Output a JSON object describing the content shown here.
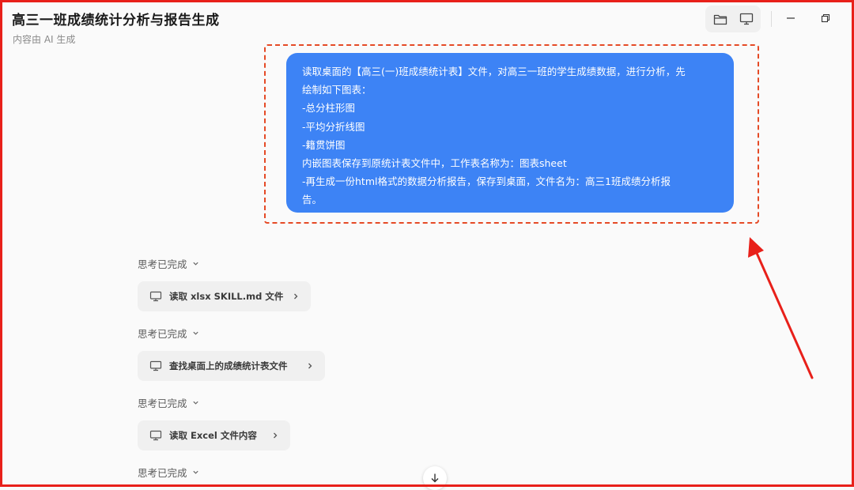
{
  "header": {
    "title": "高三一班成绩统计分析与报告生成",
    "subtitle": "内容由 AI 生成"
  },
  "toolbar": {
    "icons": [
      "folder-icon",
      "monitor-icon"
    ],
    "window_controls": [
      "minimize-icon",
      "restore-icon"
    ]
  },
  "prompt": {
    "lines": [
      "读取桌面的【高三(一)班成绩统计表】文件，对高三一班的学生成绩数据，进行分析，先",
      "绘制如下图表：",
      "-总分柱形图",
      "-平均分折线图",
      "-籍贯饼图",
      "内嵌图表保存到原统计表文件中，工作表名称为：图表sheet",
      "-再生成一份html格式的数据分析报告，保存到桌面，文件名为：高三1班成绩分析报",
      "告。"
    ]
  },
  "steps": [
    {
      "think_label": "思考已完成",
      "tool_label": "读取 xlsx SKILL.md 文件"
    },
    {
      "think_label": "思考已完成",
      "tool_label": "查找桌面上的成绩统计表文件"
    },
    {
      "think_label": "思考已完成",
      "tool_label": "读取 Excel 文件内容"
    },
    {
      "think_label": "思考已完成"
    }
  ],
  "colors": {
    "bubble": "#3d83f5",
    "annotation": "#e8201a"
  }
}
